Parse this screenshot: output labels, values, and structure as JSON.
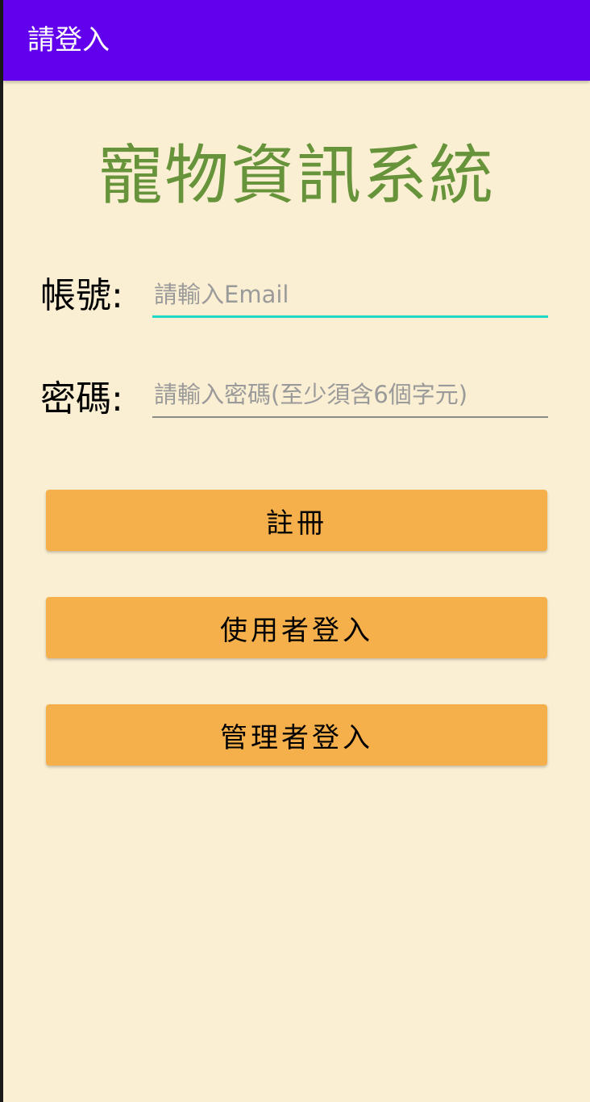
{
  "app_bar": {
    "title": "請登入"
  },
  "main": {
    "app_title": "寵物資訊系統",
    "account": {
      "label": "帳號:",
      "value": "",
      "placeholder": "請輸入Email"
    },
    "password": {
      "label": "密碼:",
      "value": "",
      "placeholder": "請輸入密碼(至少須含6個字元)"
    },
    "buttons": {
      "register": "註冊",
      "user_login": "使用者登入",
      "admin_login": "管理者登入"
    }
  },
  "colors": {
    "app_bar": "#6200EE",
    "background": "#FAEFD3",
    "title": "#67943A",
    "button": "#F5B04C",
    "focused_underline": "#1FD9C4"
  }
}
